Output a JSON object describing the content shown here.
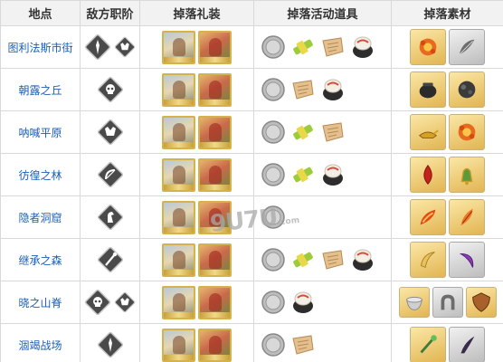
{
  "headers": {
    "location": "地点",
    "enemy_class": "敌方职阶",
    "drop_ce": "掉落礼装",
    "drop_event_items": "掉落活动道具",
    "drop_materials": "掉落素材"
  },
  "rows": [
    {
      "location": "图利法斯市街",
      "classes": [
        "lancer-icon",
        "berserker-icon"
      ],
      "ce": [
        "ce-card-a",
        "ce-card-b"
      ],
      "items": [
        "silver-coin-icon",
        "green-ticket-icon",
        "scroll-icon",
        "dumpling-icon"
      ],
      "materials": [
        "orange-flower-material",
        "gray-feather-material"
      ]
    },
    {
      "location": "朝露之丘",
      "classes": [
        "assassin-icon"
      ],
      "ce": [
        "ce-card-a",
        "ce-card-b"
      ],
      "items": [
        "silver-coin-icon",
        "scroll-icon",
        "dumpling-icon"
      ],
      "materials": [
        "black-pot-material",
        "dark-stone-material"
      ]
    },
    {
      "location": "呐喊平原",
      "classes": [
        "berserker-icon"
      ],
      "ce": [
        "ce-card-a",
        "ce-card-b"
      ],
      "items": [
        "silver-coin-icon",
        "green-ticket-icon",
        "scroll-icon"
      ],
      "materials": [
        "golden-lamp-material",
        "orange-flower-material"
      ]
    },
    {
      "location": "彷徨之林",
      "classes": [
        "archer-icon"
      ],
      "ce": [
        "ce-card-a",
        "ce-card-b"
      ],
      "items": [
        "silver-coin-icon",
        "green-ticket-icon",
        "dumpling-icon"
      ],
      "materials": [
        "red-drop-material",
        "golden-bell-material"
      ]
    },
    {
      "location": "隐者洞窟",
      "classes": [
        "rider-icon"
      ],
      "ce": [
        "ce-card-a",
        "ce-card-b"
      ],
      "items": [
        "silver-coin-icon"
      ],
      "materials": [
        "fire-feather-material",
        "phoenix-feather-material"
      ]
    },
    {
      "location": "继承之森",
      "classes": [
        "caster-icon"
      ],
      "ce": [
        "ce-card-a",
        "ce-card-b"
      ],
      "items": [
        "silver-coin-icon",
        "green-ticket-icon",
        "scroll-icon",
        "dumpling-icon"
      ],
      "materials": [
        "golden-fang-material",
        "purple-claw-material"
      ]
    },
    {
      "location": "晓之山脊",
      "classes": [
        "assassin-icon",
        "berserker-icon"
      ],
      "ce": [
        "ce-card-a",
        "ce-card-b"
      ],
      "items": [
        "silver-coin-icon",
        "dumpling-icon"
      ],
      "materials": [
        "silver-bowl-material",
        "horseshoe-material",
        "shield-material"
      ]
    },
    {
      "location": "涸竭战场",
      "classes": [
        "lancer-icon"
      ],
      "ce": [
        "ce-card-a",
        "ce-card-b"
      ],
      "items": [
        "silver-coin-icon",
        "scroll-icon"
      ],
      "materials": [
        "jade-staff-material",
        "dark-horn-material"
      ]
    }
  ],
  "watermark": "9U7U"
}
